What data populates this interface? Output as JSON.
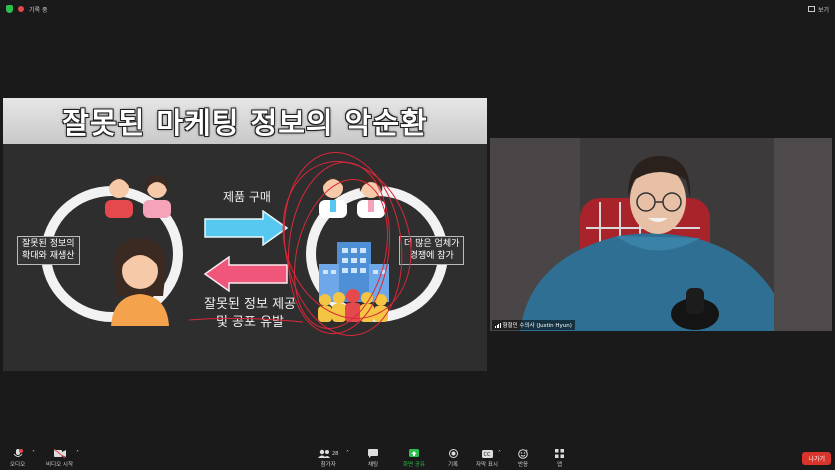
{
  "window": {
    "recording_label": "기록 중",
    "view_label": "보기"
  },
  "slide": {
    "title": "잘못된 마케팅 정보의 악순환",
    "left_label_line1": "잘못된 정보의",
    "left_label_line2": "확대와 재생산",
    "right_label_line1": "더 많은 업체가",
    "right_label_line2": "경쟁에 참가",
    "arrow_top_label": "제품 구매",
    "bottom_text_line1": "잘못된 정보 제공",
    "bottom_text_line2": "및 공포 유발"
  },
  "participant": {
    "name": "형철민 수의사 (Justin Hyun)"
  },
  "toolbar": {
    "audio": "오디오",
    "video": "비디오 시작",
    "participants": "참가자",
    "participants_count": "28",
    "chat": "채팅",
    "share": "화면 공유",
    "record": "기록",
    "captions": "자막 표시",
    "reactions": "반응",
    "apps": "앱",
    "leave": "나가기"
  },
  "colors": {
    "accent_green": "#2dbf4e",
    "leave_red": "#d9342b",
    "arrow_blue": "#57c8f0",
    "arrow_pink": "#f0567a"
  }
}
